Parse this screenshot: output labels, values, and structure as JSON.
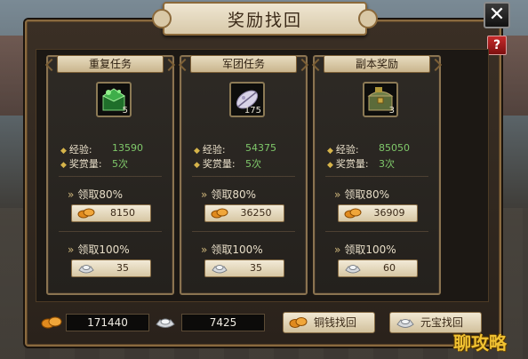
{
  "window": {
    "title": "奖励找回"
  },
  "cards": [
    {
      "tab": "重复任务",
      "item": {
        "name": "green-cube-item-icon",
        "qty": "5"
      },
      "exp_label": "经验:",
      "exp_value": "13590",
      "reward_label": "奖赏量:",
      "reward_value": "5次",
      "claim80_label": "领取80%",
      "claim80_amount": "8150",
      "claim100_label": "领取100%",
      "claim100_amount": "35"
    },
    {
      "tab": "军团任务",
      "item": {
        "name": "silver-leaf-item-icon",
        "qty": "175"
      },
      "exp_label": "经验:",
      "exp_value": "54375",
      "reward_label": "奖赏量:",
      "reward_value": "5次",
      "claim80_label": "领取80%",
      "claim80_amount": "36250",
      "claim100_label": "领取100%",
      "claim100_amount": "35"
    },
    {
      "tab": "副本奖励",
      "item": {
        "name": "treasure-chest-item-icon",
        "qty": "3"
      },
      "exp_label": "经验:",
      "exp_value": "85050",
      "reward_label": "奖赏量:",
      "reward_value": "3次",
      "claim80_label": "领取80%",
      "claim80_amount": "36909",
      "claim100_label": "领取100%",
      "claim100_amount": "60"
    }
  ],
  "bottom": {
    "copper_total": "171440",
    "ingot_total": "7425",
    "copper_button": "铜钱找回",
    "ingot_button": "元宝找回"
  },
  "controls": {
    "close": "✕",
    "help": "?"
  },
  "watermark": "聊攻略",
  "colors": {
    "accent_gold": "#d6b44a",
    "value_green": "#7fc86a",
    "help_red": "#c62a2a"
  }
}
